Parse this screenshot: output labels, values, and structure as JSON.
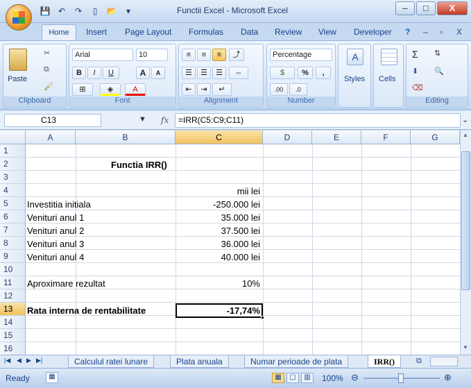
{
  "window": {
    "title": "Functii Excel - Microsoft Excel",
    "minimize": "–",
    "maximize": "□",
    "close": "X"
  },
  "ribbon_tabs": [
    "Home",
    "Insert",
    "Page Layout",
    "Formulas",
    "Data",
    "Review",
    "View",
    "Developer"
  ],
  "ribbon_right": {
    "help": "?",
    "min": "–",
    "restore": "▫",
    "close": "X"
  },
  "ribbon": {
    "clipboard": {
      "label": "Clipboard",
      "paste": "Paste"
    },
    "font": {
      "label": "Font",
      "name": "Arial",
      "size": "10",
      "bold": "B",
      "italic": "I",
      "underline": "U",
      "grow": "A",
      "shrink": "A"
    },
    "alignment": {
      "label": "Alignment"
    },
    "number": {
      "label": "Number",
      "format": "Percentage",
      "percent": "%",
      "comma": ","
    },
    "styles": {
      "label": "Styles"
    },
    "cells": {
      "label": "Cells"
    },
    "editing": {
      "label": "Editing",
      "sum": "Σ"
    }
  },
  "formula_bar": {
    "name_box": "C13",
    "fx": "fx",
    "formula": "=IRR(C5:C9;C11)"
  },
  "columns": [
    "A",
    "B",
    "C",
    "D",
    "E",
    "F",
    "G"
  ],
  "rows": [
    "1",
    "2",
    "3",
    "4",
    "5",
    "6",
    "7",
    "8",
    "9",
    "10",
    "11",
    "12",
    "13",
    "14",
    "15",
    "16"
  ],
  "cells": {
    "title": "Functia IRR()",
    "unit": "mii lei",
    "r5a": "Investitia initiala",
    "r5c": "-250.000 lei",
    "r6a": "Venituri anul 1",
    "r6c": "35.000 lei",
    "r7a": "Venituri anul 2",
    "r7c": "37.500 lei",
    "r8a": "Venituri anul 3",
    "r8c": "36.000 lei",
    "r9a": "Venituri anul 4",
    "r9c": "40.000 lei",
    "r11a": "Aproximare rezultat",
    "r11c": "10%",
    "r13a": "Rata interna de rentabilitate",
    "r13c": "-17,74%"
  },
  "sheet_tabs": [
    "Calculul ratei lunare",
    "Plata anuala",
    "Numar perioade de plata",
    "IRR()"
  ],
  "active_sheet": "IRR()",
  "status": {
    "mode": "Ready",
    "zoom": "100%"
  }
}
